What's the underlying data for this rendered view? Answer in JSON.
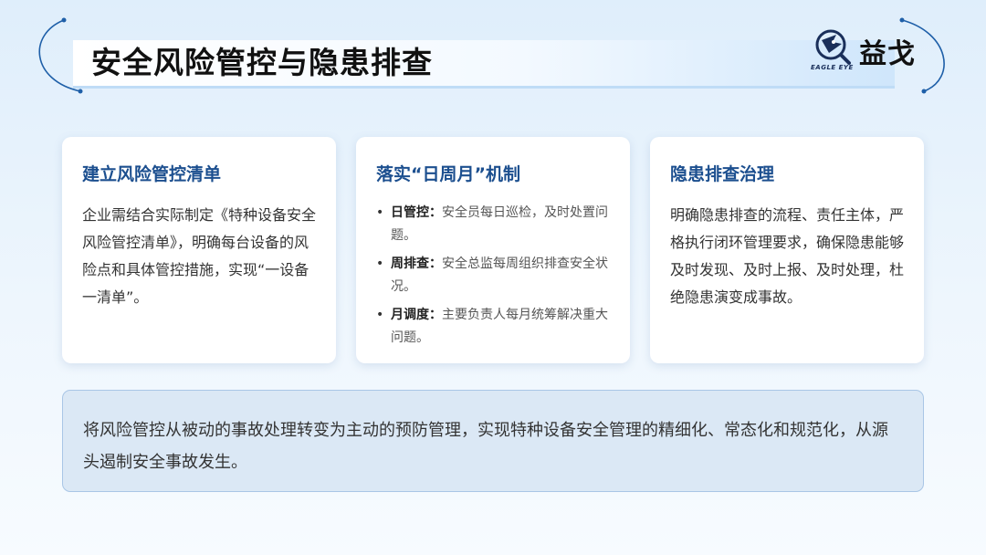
{
  "header": {
    "title": "安全风险管控与隐患排查",
    "logo_text": "益戈",
    "logo_sub": "EAGLE EYE"
  },
  "cards": [
    {
      "title": "建立风险管控清单",
      "body": "企业需结合实际制定《特种设备安全风险管控清单》，明确每台设备的风险点和具体管控措施，实现“一设备一清单”。"
    },
    {
      "title": "落实“日周月”机制",
      "items": [
        {
          "key": "日管控：",
          "text": "安全员每日巡检，及时处置问题。"
        },
        {
          "key": "周排查：",
          "text": "安全总监每周组织排查安全状况。"
        },
        {
          "key": "月调度：",
          "text": "主要负责人每月统筹解决重大问题。"
        }
      ]
    },
    {
      "title": "隐患排查治理",
      "body": "明确隐患排查的流程、责任主体，严格执行闭环管理要求，确保隐患能够及时发现、及时上报、及时处理，杜绝隐患演变成事故。"
    }
  ],
  "summary": "将风险管控从被动的事故处理转变为主动的预防管理，实现特种设备安全管理的精细化、常态化和规范化，从源头遏制安全事故发生。",
  "colors": {
    "accent": "#1c4f8f",
    "summary_bg": "#dbe8f5",
    "summary_border": "#a9c6e6"
  },
  "icons": {
    "logo": "eagle-magnifier-icon"
  }
}
